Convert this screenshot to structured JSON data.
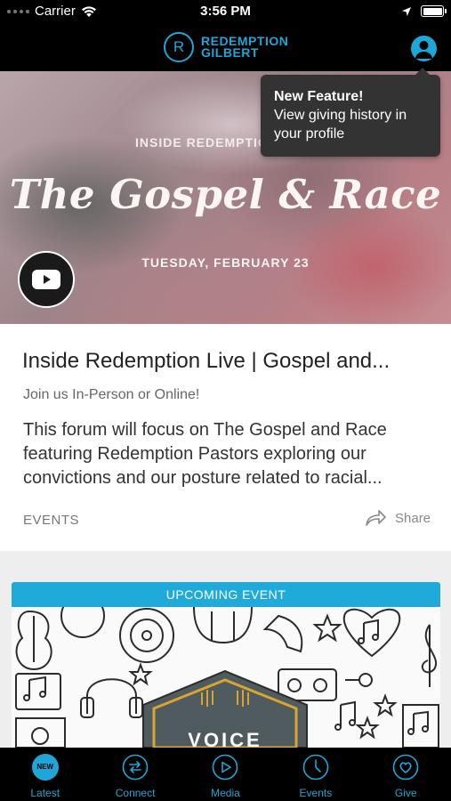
{
  "status_bar": {
    "carrier": "Carrier",
    "time": "3:56 PM",
    "icons": [
      "wifi-icon",
      "location-arrow-icon",
      "battery-icon"
    ]
  },
  "header": {
    "logo_letter": "R",
    "logo_line1": "REDEMPTION",
    "logo_line2": "GILBERT",
    "accent_color": "#1fa6d8"
  },
  "tooltip": {
    "title": "New Feature!",
    "body": "View giving history in your profile"
  },
  "hero": {
    "eyebrow": "INSIDE REDEMPTION",
    "title": "The Gospel & Race",
    "date": "TUESDAY, FEBRUARY 23"
  },
  "card": {
    "title": "Inside Redemption Live | Gospel and...",
    "subtitle": "Join us In-Person or Online!",
    "description": "This forum will focus on The Gospel and Race featuring Redemption Pastors exploring our convictions and our posture related to racial...",
    "category": "EVENTS",
    "share_label": "Share"
  },
  "upcoming": {
    "badge": "UPCOMING EVENT",
    "art_text": "VOICE"
  },
  "tabs": [
    {
      "label": "Latest",
      "icon": "new-badge-icon",
      "badge": "NEW"
    },
    {
      "label": "Connect",
      "icon": "connect-arrows-icon"
    },
    {
      "label": "Media",
      "icon": "play-circle-icon"
    },
    {
      "label": "Events",
      "icon": "clock-icon"
    },
    {
      "label": "Give",
      "icon": "heart-icon"
    }
  ]
}
